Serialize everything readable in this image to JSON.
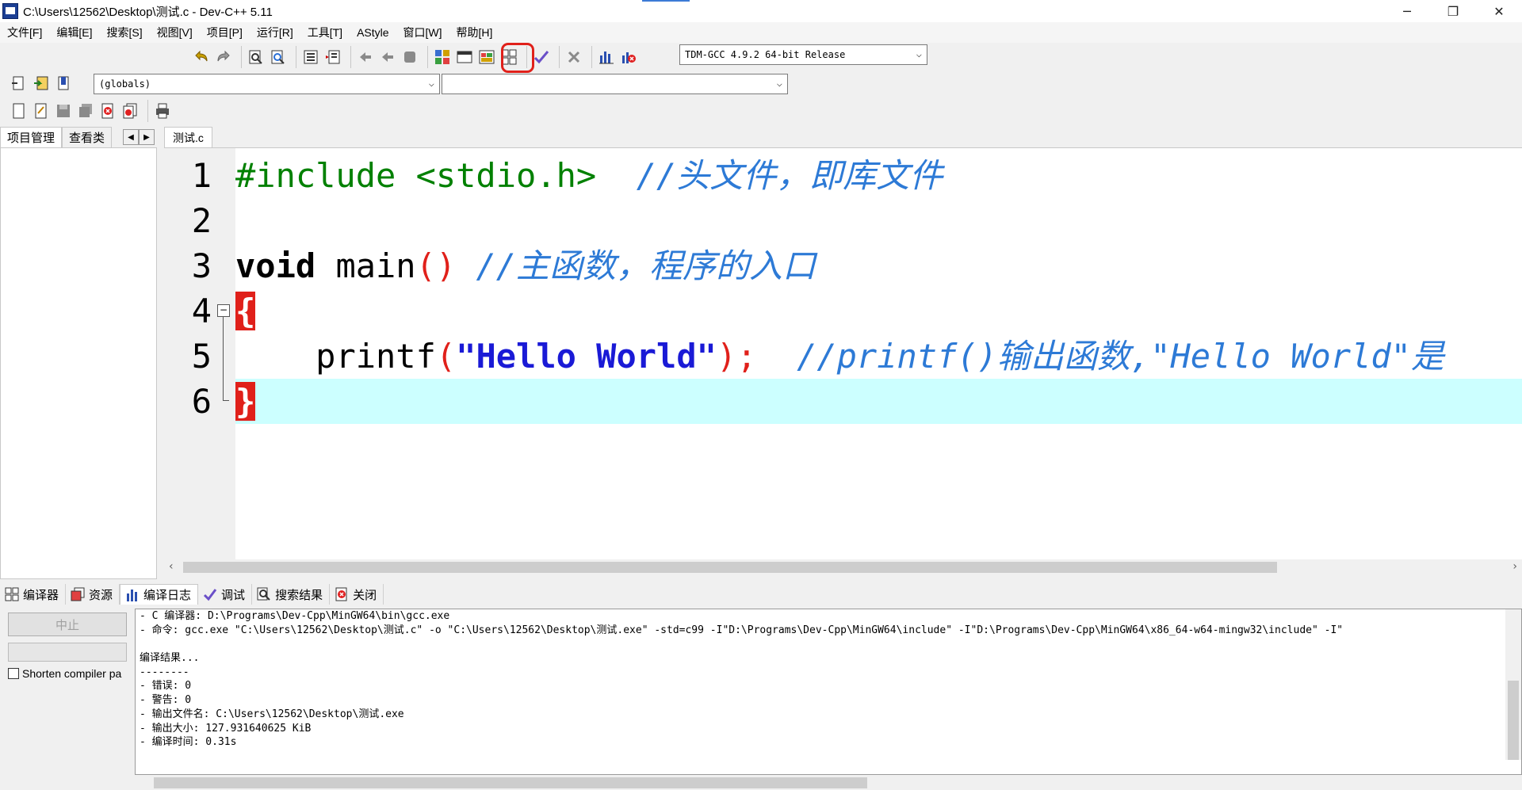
{
  "window": {
    "title": "C:\\Users\\12562\\Desktop\\测试.c - Dev-C++ 5.11",
    "buttons": {
      "minimize": "─",
      "maximize": "❐",
      "close": "✕"
    }
  },
  "menu": {
    "items": [
      "文件[F]",
      "编辑[E]",
      "搜索[S]",
      "视图[V]",
      "项目[P]",
      "运行[R]",
      "工具[T]",
      "AStyle",
      "窗口[W]",
      "帮助[H]"
    ]
  },
  "toolbar": {
    "compiler_select": "TDM-GCC 4.9.2 64-bit Release",
    "scope_select": "(globals)",
    "member_select": ""
  },
  "left_tabs": [
    "项目管理",
    "查看类"
  ],
  "editor": {
    "file_tab": "测试.c",
    "line_numbers": [
      "1",
      "2",
      "3",
      "4",
      "5",
      "6"
    ],
    "line1": {
      "directive": "#include <stdio.h>",
      "comment": "//头文件，即库文件"
    },
    "line3": {
      "keyword": "void",
      "name": " main",
      "parens": "()",
      "comment": "//主函数，程序的入口"
    },
    "line4": {
      "brace": "{"
    },
    "line5": {
      "indent": "    ",
      "func": "printf",
      "open": "(",
      "string": "\"Hello World\"",
      "close": ");",
      "comment": "//printf()输出函数,\"Hello World\"是"
    },
    "line6": {
      "brace": "}"
    }
  },
  "bottom": {
    "tabs": [
      "编译器",
      "资源",
      "编译日志",
      "调试",
      "搜索结果",
      "关闭"
    ],
    "abort_label": "中止",
    "shorten_label": "Shorten compiler pa",
    "log": [
      "- C 编译器: D:\\Programs\\Dev-Cpp\\MinGW64\\bin\\gcc.exe",
      "- 命令: gcc.exe \"C:\\Users\\12562\\Desktop\\测试.c\" -o \"C:\\Users\\12562\\Desktop\\测试.exe\" -std=c99 -I\"D:\\Programs\\Dev-Cpp\\MinGW64\\include\" -I\"D:\\Programs\\Dev-Cpp\\MinGW64\\x86_64-w64-mingw32\\include\" -I\"",
      "",
      "编译结果...",
      "--------",
      "- 错误: 0",
      "- 警告: 0",
      "- 输出文件名: C:\\Users\\12562\\Desktop\\测试.exe",
      "- 输出大小: 127.931640625 KiB",
      "- 编译时间: 0.31s"
    ]
  },
  "colors": {
    "keyword_preprocessor": "#008000",
    "comment": "#2d7ad6",
    "string": "#1a1ad6",
    "brace_highlight": "#e0201a",
    "current_line": "#ccffff"
  }
}
